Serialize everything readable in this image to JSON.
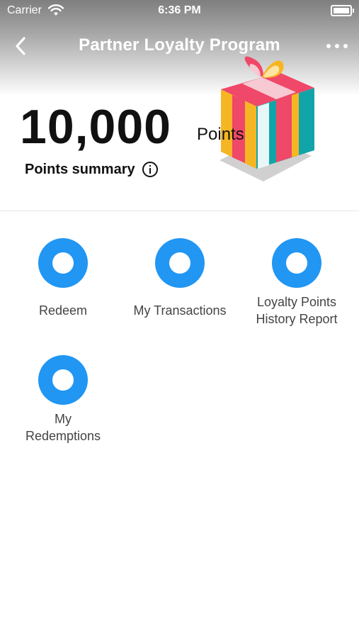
{
  "status_bar": {
    "carrier": "Carrier",
    "time": "6:36 PM",
    "icons": [
      "wifi-icon",
      "battery-icon"
    ]
  },
  "nav": {
    "title": "Partner Loyalty Program",
    "back_icon": "chevron-left-icon",
    "more_icon": "more-horizontal-icon"
  },
  "points": {
    "value": "10,000",
    "unit": "Points",
    "summary_label": "Points summary",
    "summary_icon": "info-icon"
  },
  "illustration": "gift-box-illustration",
  "menu": {
    "icon": "circle-icon",
    "accent_color": "#2196f3",
    "items": [
      {
        "label": "Redeem"
      },
      {
        "label": "My Transactions"
      },
      {
        "label": "Loyalty Points\nHistory Report"
      },
      {
        "label": "My\nRedemptions"
      }
    ]
  }
}
